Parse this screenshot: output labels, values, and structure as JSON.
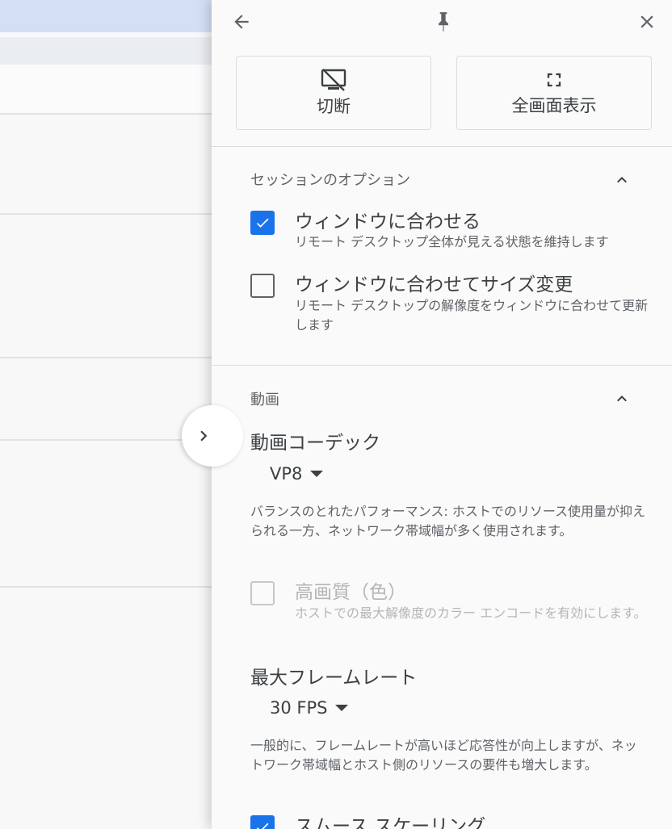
{
  "toolbar": {
    "back_icon": "arrow-back-icon",
    "pin_icon": "pin-icon",
    "close_icon": "close-icon"
  },
  "actions": {
    "disconnect_label": "切断",
    "disconnect_icon": "desktop-off-icon",
    "fullscreen_label": "全画面表示",
    "fullscreen_icon": "fullscreen-icon"
  },
  "session_options": {
    "title": "セッションのオプション",
    "fit_window": {
      "label": "ウィンドウに合わせる",
      "description": "リモート デスクトップ全体が見える状態を維持します",
      "checked": true
    },
    "resize_to_fit": {
      "label": "ウィンドウに合わせてサイズ変更",
      "description": "リモート デスクトップの解像度をウィンドウに合わせて更新します",
      "checked": false
    }
  },
  "video": {
    "title": "動画",
    "codec_label": "動画コーデック",
    "codec_value": "VP8",
    "codec_help": "バランスのとれたパフォーマンス: ホストでのリソース使用量が抑えられる一方、ネットワーク帯域幅が多く使用されます。",
    "high_quality": {
      "label": "高画質（色）",
      "description": "ホストでの最大解像度のカラー エンコードを有効にします。",
      "checked": false,
      "disabled": true
    },
    "framerate_label": "最大フレームレート",
    "framerate_value": "30 FPS",
    "framerate_help": "一般的に、フレームレートが高いほど応答性が向上しますが、ネットワーク帯域幅とホスト側のリソースの要件も増大します。",
    "smooth_scaling": {
      "label": "スムース スケーリング",
      "checked": true
    }
  },
  "colors": {
    "accent": "#1a73e8",
    "panel_bg": "#fafafa"
  }
}
